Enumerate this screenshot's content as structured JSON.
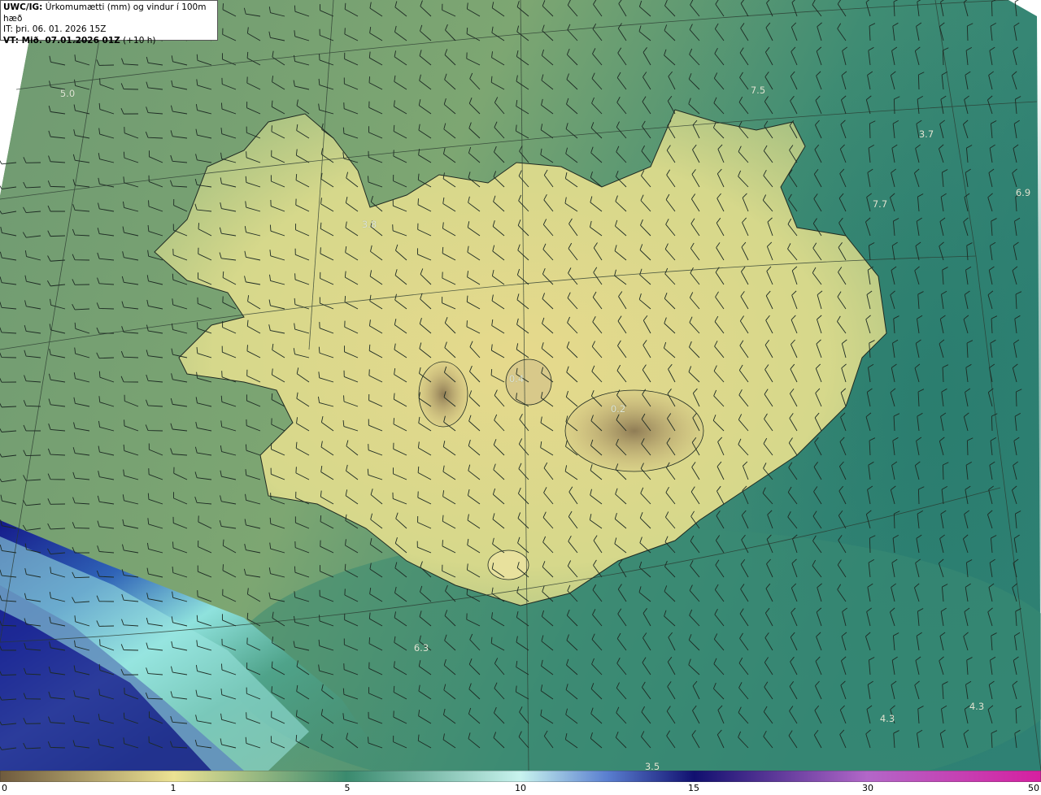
{
  "header": {
    "line1_prefix": "UWC/IG:",
    "line1_text": "Úrkomumætti (mm) og vindur í 100m hæð",
    "line2": "IT: þri. 06. 01. 2026 15Z",
    "line3_prefix": "VT: Mið. 07.01.2026 01Z",
    "line3_suffix": "(+10 h)"
  },
  "map": {
    "field": "precipitable water (mm)",
    "value_labels": [
      "5.0",
      "7.5",
      "3.7",
      "6.9",
      "7.7",
      "3.8",
      "0.4",
      "0.2",
      "6.3",
      "4.3",
      "4.3",
      "3.5"
    ],
    "overlay": "wind barbs at 100m",
    "palette": {
      "low_dry": "#8a7a58",
      "dry": "#e9de8c",
      "mid": "#3f8a6e",
      "moist": "#2a7d6d",
      "wet_light": "#c8f1ec",
      "very_wet": "#0e1170",
      "extreme": "#c31fa8"
    }
  },
  "colorbar": {
    "ticks": [
      "0",
      "1",
      "5",
      "10",
      "15",
      "30",
      "50"
    ]
  }
}
